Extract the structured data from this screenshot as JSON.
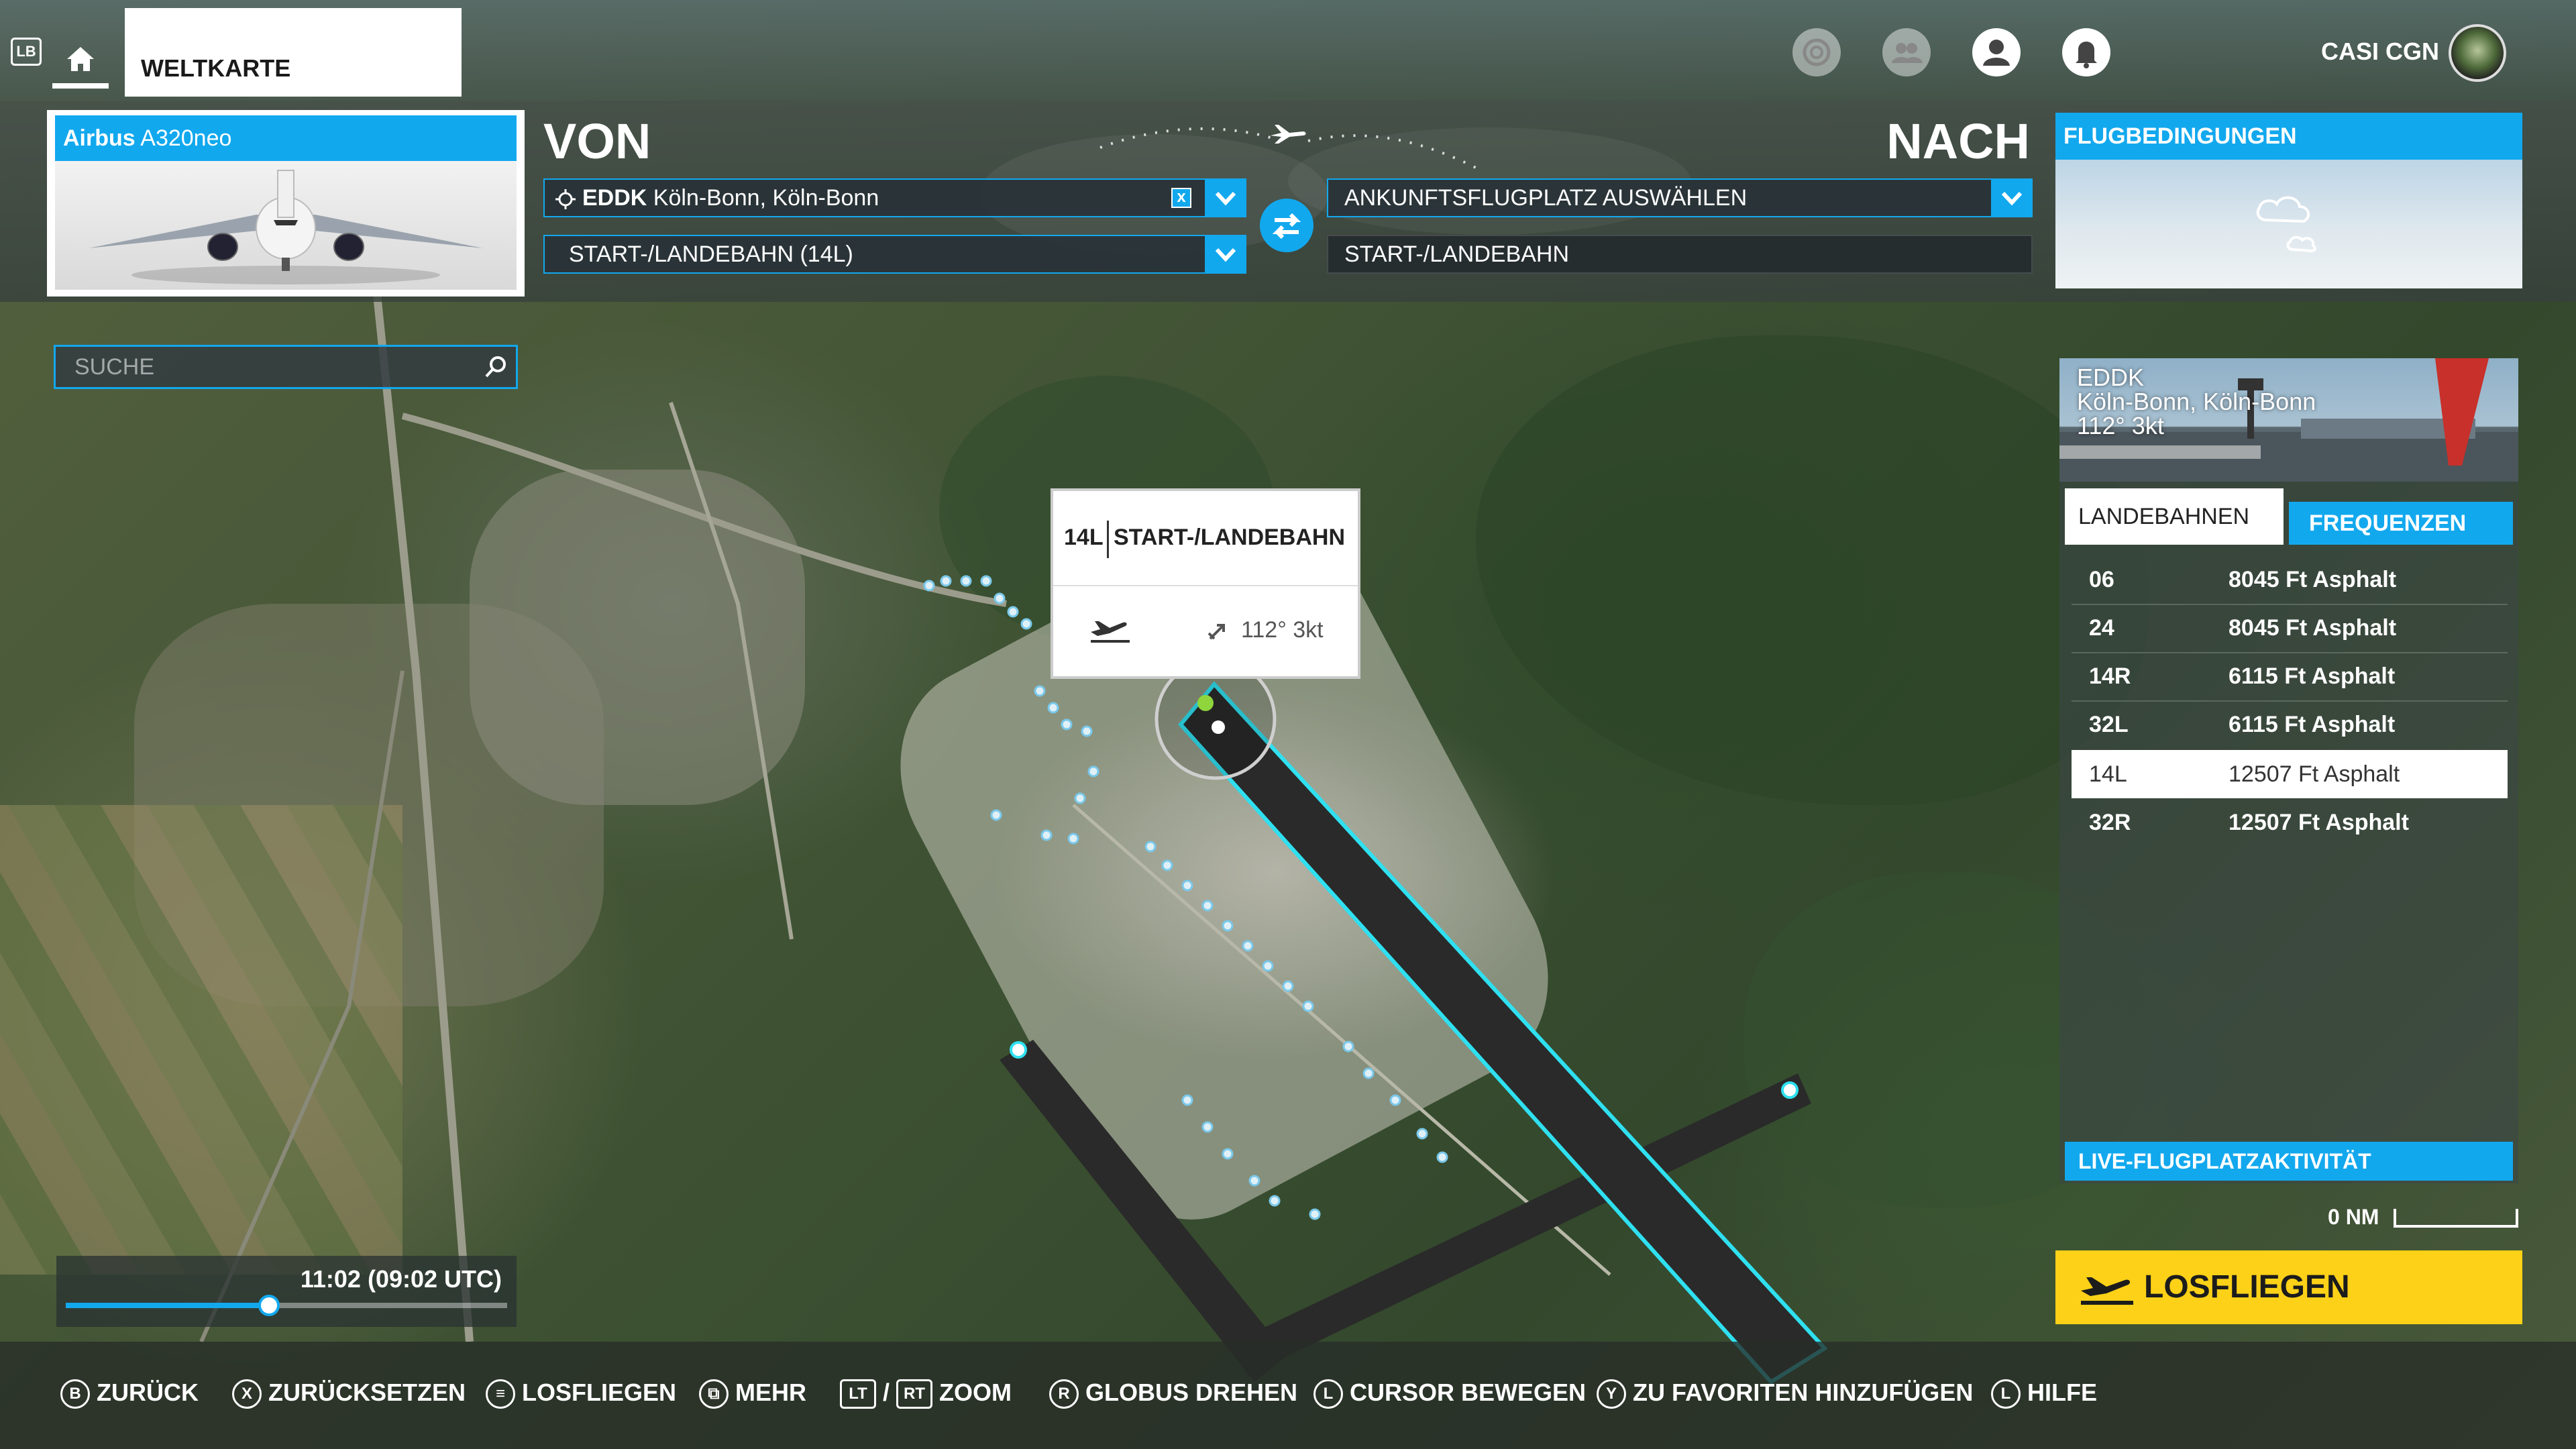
{
  "topbar": {
    "lb_badge": "LB",
    "tab_label": "WELTKARTE",
    "user_name": "CASI CGN"
  },
  "aircraft": {
    "brand": "Airbus",
    "model": "A320neo"
  },
  "departure": {
    "label": "VON",
    "airport_code": "EDDK",
    "airport_name": "Köln-Bonn, Köln-Bonn",
    "clear_glyph": "x",
    "runway": "START-/LANDEBAHN (14L)"
  },
  "arrival": {
    "label": "NACH",
    "airport_placeholder": "ANKUNFTSFLUGPLATZ AUSWÄHLEN",
    "runway": "START-/LANDEBAHN"
  },
  "weather": {
    "title": "FLUGBEDINGUNGEN"
  },
  "search": {
    "placeholder": "SUCHE"
  },
  "tooltip": {
    "runway_id": "14L",
    "runway_label": "START-/LANDEBAHN",
    "wind": "112° 3kt"
  },
  "airport_info": {
    "code": "EDDK",
    "name": "Köln-Bonn, Köln-Bonn",
    "wind": "112° 3kt",
    "tabs": {
      "runways": "LANDEBAHNEN",
      "frequencies": "FREQUENZEN"
    },
    "runways": [
      {
        "id": "06",
        "desc": "8045 Ft Asphalt",
        "selected": false
      },
      {
        "id": "24",
        "desc": "8045 Ft Asphalt",
        "selected": false
      },
      {
        "id": "14R",
        "desc": "6115 Ft Asphalt",
        "selected": false
      },
      {
        "id": "32L",
        "desc": "6115 Ft Asphalt",
        "selected": false
      },
      {
        "id": "14L",
        "desc": "12507 Ft Asphalt",
        "selected": true
      },
      {
        "id": "32R",
        "desc": "12507 Ft Asphalt",
        "selected": false
      }
    ],
    "live_activity": "LIVE-FLUGPLATZAKTIVITÄT"
  },
  "scale": {
    "label": "0 NM"
  },
  "fly_button": {
    "label": "LOSFLIEGEN"
  },
  "time": {
    "label": "11:02 (09:02 UTC)",
    "slider_fraction": 0.46
  },
  "footer": [
    {
      "glyph": "B",
      "label": "ZURÜCK",
      "shape": "circle",
      "icon": "b-button-icon"
    },
    {
      "glyph": "X",
      "label": "ZURÜCKSETZEN",
      "shape": "circle",
      "icon": "x-button-icon"
    },
    {
      "glyph": "≡",
      "label": "LOSFLIEGEN",
      "shape": "circle",
      "icon": "menu-button-icon"
    },
    {
      "glyph": "⧉",
      "label": "MEHR",
      "shape": "circle",
      "icon": "view-button-icon"
    },
    {
      "glyph": "LT",
      "sep": "/",
      "glyph2": "RT",
      "label": "ZOOM",
      "shape": "square",
      "icon": "trigger-buttons-icon"
    },
    {
      "glyph": "R",
      "label": "GLOBUS DREHEN",
      "shape": "circle",
      "icon": "right-stick-icon"
    },
    {
      "glyph": "L",
      "label": "CURSOR BEWEGEN",
      "shape": "circle",
      "icon": "left-stick-icon"
    },
    {
      "glyph": "Y",
      "label": "ZU FAVORITEN HINZUFÜGEN",
      "shape": "circle",
      "icon": "y-button-icon"
    },
    {
      "glyph": "L",
      "label": "HILFE",
      "shape": "circle",
      "icon": "left-stick-click-icon"
    }
  ],
  "colors": {
    "accent": "#12a8ee",
    "fly_button": "#fcd117",
    "runway_outline": "#2fe0f0"
  }
}
